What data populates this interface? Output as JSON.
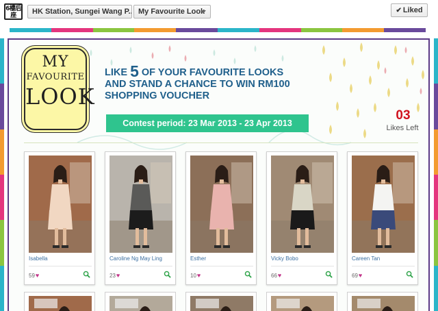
{
  "header": {
    "logo_text": "6樓后座",
    "page_selector": "HK Station, Sungei Wang P...",
    "app_selector": "My Favourite Look",
    "liked_label": "Liked"
  },
  "colors": {
    "stripe": [
      "#2bb5c9",
      "#e4357e",
      "#8bc540",
      "#f39b30",
      "#6a4a9c",
      "#2bb5c9",
      "#e4357e",
      "#8bc540",
      "#f39b30",
      "#6a4a9c"
    ],
    "headline": "#1f5f8b",
    "contest_bg": "#2fc48e",
    "likes_count": "#d0121e",
    "badge_bg": "#fcf7a6"
  },
  "badge": {
    "line1": "MY",
    "line2": "FAVOURITE",
    "line3": "LOOK"
  },
  "promo": {
    "line1_pre": "LIKE ",
    "line1_num": "5",
    "line1_post": " OF YOUR FAVOURITE LOOKS",
    "line2": "AND STAND A CHANCE TO WIN RM100",
    "line3": "SHOPPING VOUCHER",
    "contest_period": "Contest period: 23 Mar 2013 - 23 Apr 2013"
  },
  "likes_left": {
    "count": "03",
    "label": "Likes Left"
  },
  "entries": [
    {
      "name": "Isabella",
      "votes": "59",
      "outfit": "#f1d7c2",
      "bottom": "#f1d7c2",
      "bg": "#a06a4a"
    },
    {
      "name": "Caroline Ng May Ling",
      "votes": "23",
      "outfit": "#5a5a58",
      "bottom": "#1c1c1c",
      "bg": "#b9b4ac"
    },
    {
      "name": "Esther",
      "votes": "10",
      "outfit": "#e9b3ae",
      "bottom": "#e9b3ae",
      "bg": "#8c6f58"
    },
    {
      "name": "Vicky Bobo",
      "votes": "66",
      "outfit": "#d9d6c6",
      "bottom": "#1a1a1a",
      "bg": "#a08a74"
    },
    {
      "name": "Careen Tan",
      "votes": "69",
      "outfit": "#f4f4f2",
      "bottom": "#3a4a7a",
      "bg": "#9b6e4c"
    }
  ]
}
